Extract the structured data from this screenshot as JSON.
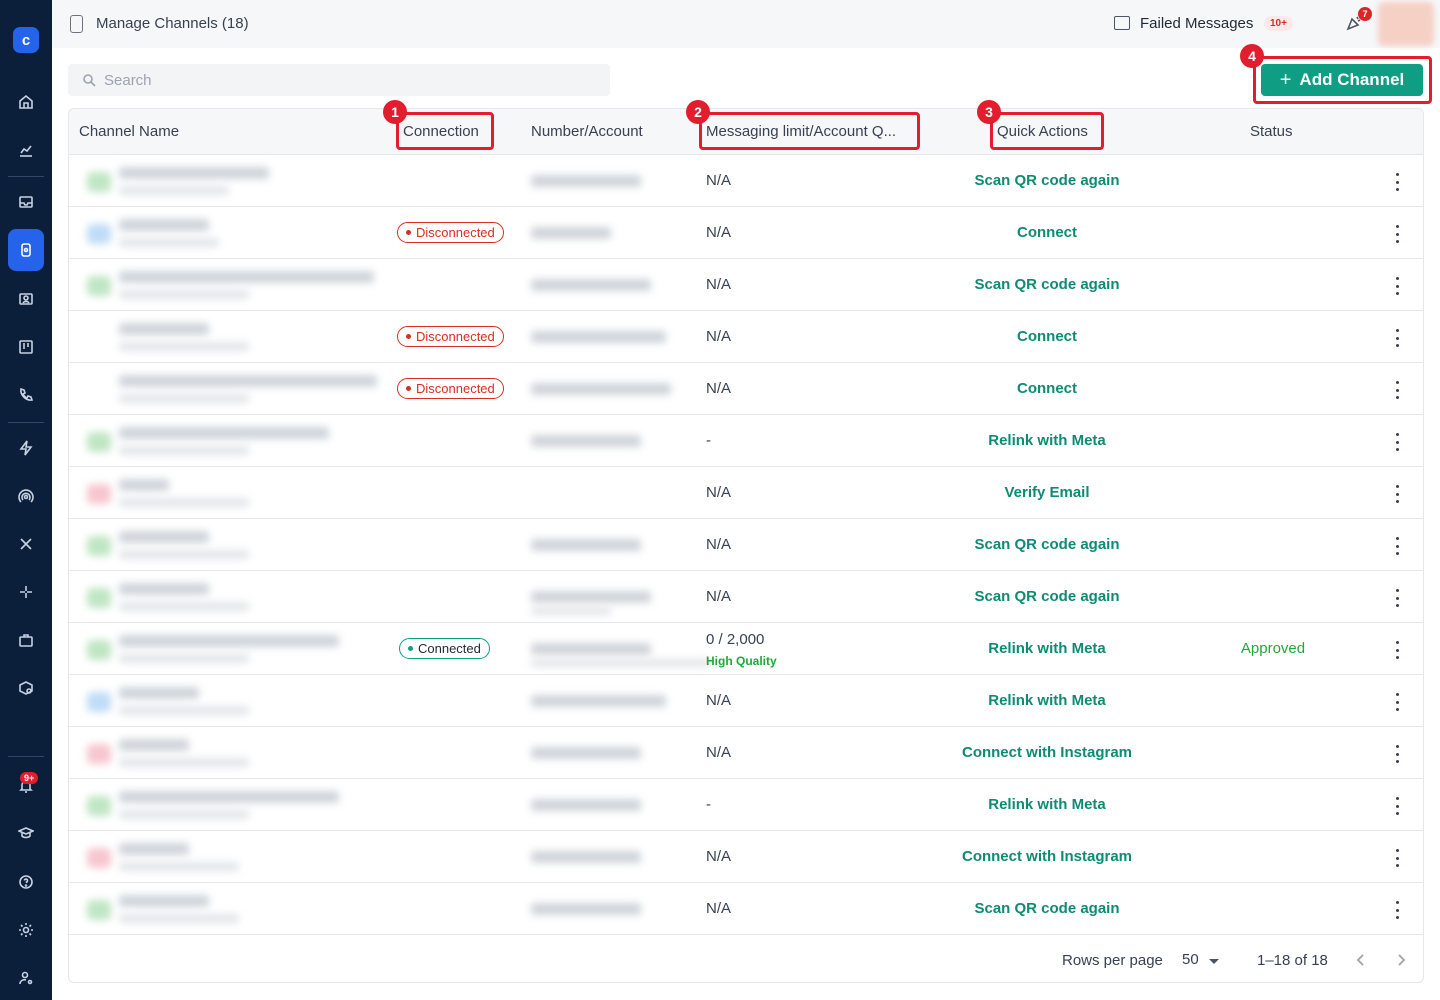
{
  "topbar": {
    "title": "Manage Channels  (18)",
    "failed_label": "Failed Messages",
    "failed_count": "10+",
    "bell_count": "7"
  },
  "sidebar": {
    "notification_count": "9+"
  },
  "search": {
    "placeholder": "Search"
  },
  "add_channel": {
    "label": "Add Channel"
  },
  "columns": [
    "Channel Name",
    "Connection",
    "Number/Account",
    "Messaging limit/Account Q...",
    "Quick Actions",
    "Status"
  ],
  "rows": [
    {
      "connection": "",
      "limit": "N/A",
      "quality": "",
      "action": "Scan QR code again",
      "status": ""
    },
    {
      "connection": "Disconnected",
      "limit": "N/A",
      "quality": "",
      "action": "Connect",
      "status": ""
    },
    {
      "connection": "",
      "limit": "N/A",
      "quality": "",
      "action": "Scan QR code again",
      "status": ""
    },
    {
      "connection": "Disconnected",
      "limit": "N/A",
      "quality": "",
      "action": "Connect",
      "status": ""
    },
    {
      "connection": "Disconnected",
      "limit": "N/A",
      "quality": "",
      "action": "Connect",
      "status": ""
    },
    {
      "connection": "",
      "limit": "-",
      "quality": "",
      "action": "Relink with Meta",
      "status": ""
    },
    {
      "connection": "",
      "limit": "N/A",
      "quality": "",
      "action": "Verify Email",
      "status": ""
    },
    {
      "connection": "",
      "limit": "N/A",
      "quality": "",
      "action": "Scan QR code again",
      "status": ""
    },
    {
      "connection": "",
      "limit": "N/A",
      "quality": "",
      "action": "Scan QR code again",
      "status": ""
    },
    {
      "connection": "Connected",
      "limit": "0 / 2,000",
      "quality": "High Quality",
      "action": "Relink with Meta",
      "status": "Approved"
    },
    {
      "connection": "",
      "limit": "N/A",
      "quality": "",
      "action": "Relink with Meta",
      "status": ""
    },
    {
      "connection": "",
      "limit": "N/A",
      "quality": "",
      "action": "Connect with Instagram",
      "status": ""
    },
    {
      "connection": "",
      "limit": "-",
      "quality": "",
      "action": "Relink with Meta",
      "status": ""
    },
    {
      "connection": "",
      "limit": "N/A",
      "quality": "",
      "action": "Connect with Instagram",
      "status": ""
    },
    {
      "connection": "",
      "limit": "N/A",
      "quality": "",
      "action": "Scan QR code again",
      "status": ""
    }
  ],
  "footer": {
    "rows_label": "Rows per page",
    "rows_value": "50",
    "range": "1–18 of 18"
  },
  "annotations": [
    "1",
    "2",
    "3",
    "4"
  ],
  "colors": {
    "sidebar": "#0b1f3a",
    "accent": "#0f9d84",
    "action_text": "#0f8a74",
    "highlight": "#e11d2e"
  }
}
